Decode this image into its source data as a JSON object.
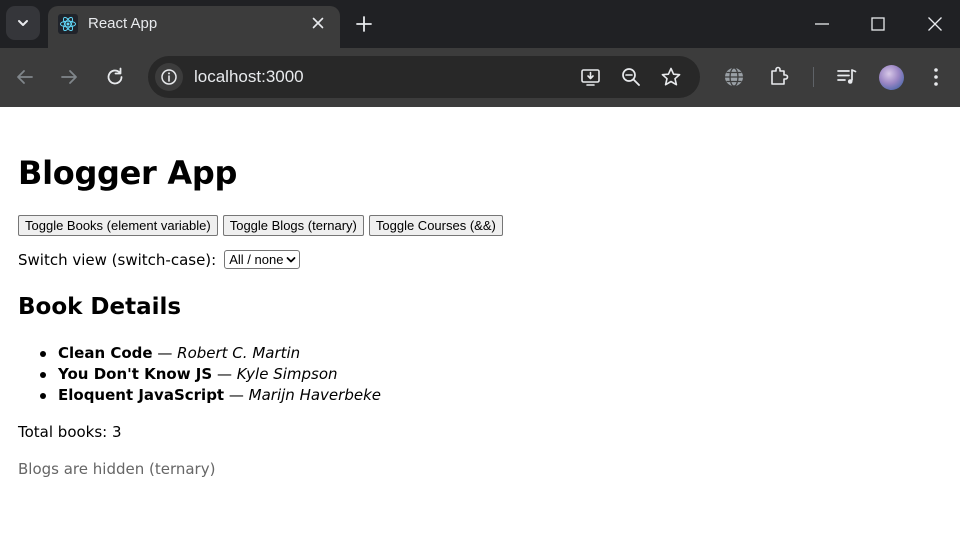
{
  "browser": {
    "tab": {
      "title": "React App",
      "favicon": "react-logo-icon"
    },
    "address_bar": {
      "url": "localhost:3000"
    },
    "toolbar_icons": [
      "back-icon",
      "forward-icon",
      "reload-icon",
      "site-info-icon",
      "install-app-icon",
      "zoom-icon",
      "bookmark-star-icon",
      "translate-icon",
      "extensions-icon",
      "media-controls-icon",
      "profile-avatar",
      "menu-icon"
    ],
    "window_controls": [
      "minimize-icon",
      "maximize-icon",
      "close-window-icon"
    ]
  },
  "app": {
    "title": "Blogger App",
    "buttons": {
      "toggle_books": "Toggle Books (element variable)",
      "toggle_blogs": "Toggle Blogs (ternary)",
      "toggle_courses": "Toggle Courses (&&)"
    },
    "switch_view": {
      "label": "Switch view (switch-case):",
      "selected": "All / none"
    },
    "book_details": {
      "heading": "Book Details",
      "separator": "—",
      "books": [
        {
          "title": "Clean Code",
          "author": "Robert C. Martin"
        },
        {
          "title": "You Don't Know JS",
          "author": "Kyle Simpson"
        },
        {
          "title": "Eloquent JavaScript",
          "author": "Marijn Haverbeke"
        }
      ],
      "total": "Total books: 3"
    },
    "blogs_hidden_note": "Blogs are hidden (ternary)"
  }
}
